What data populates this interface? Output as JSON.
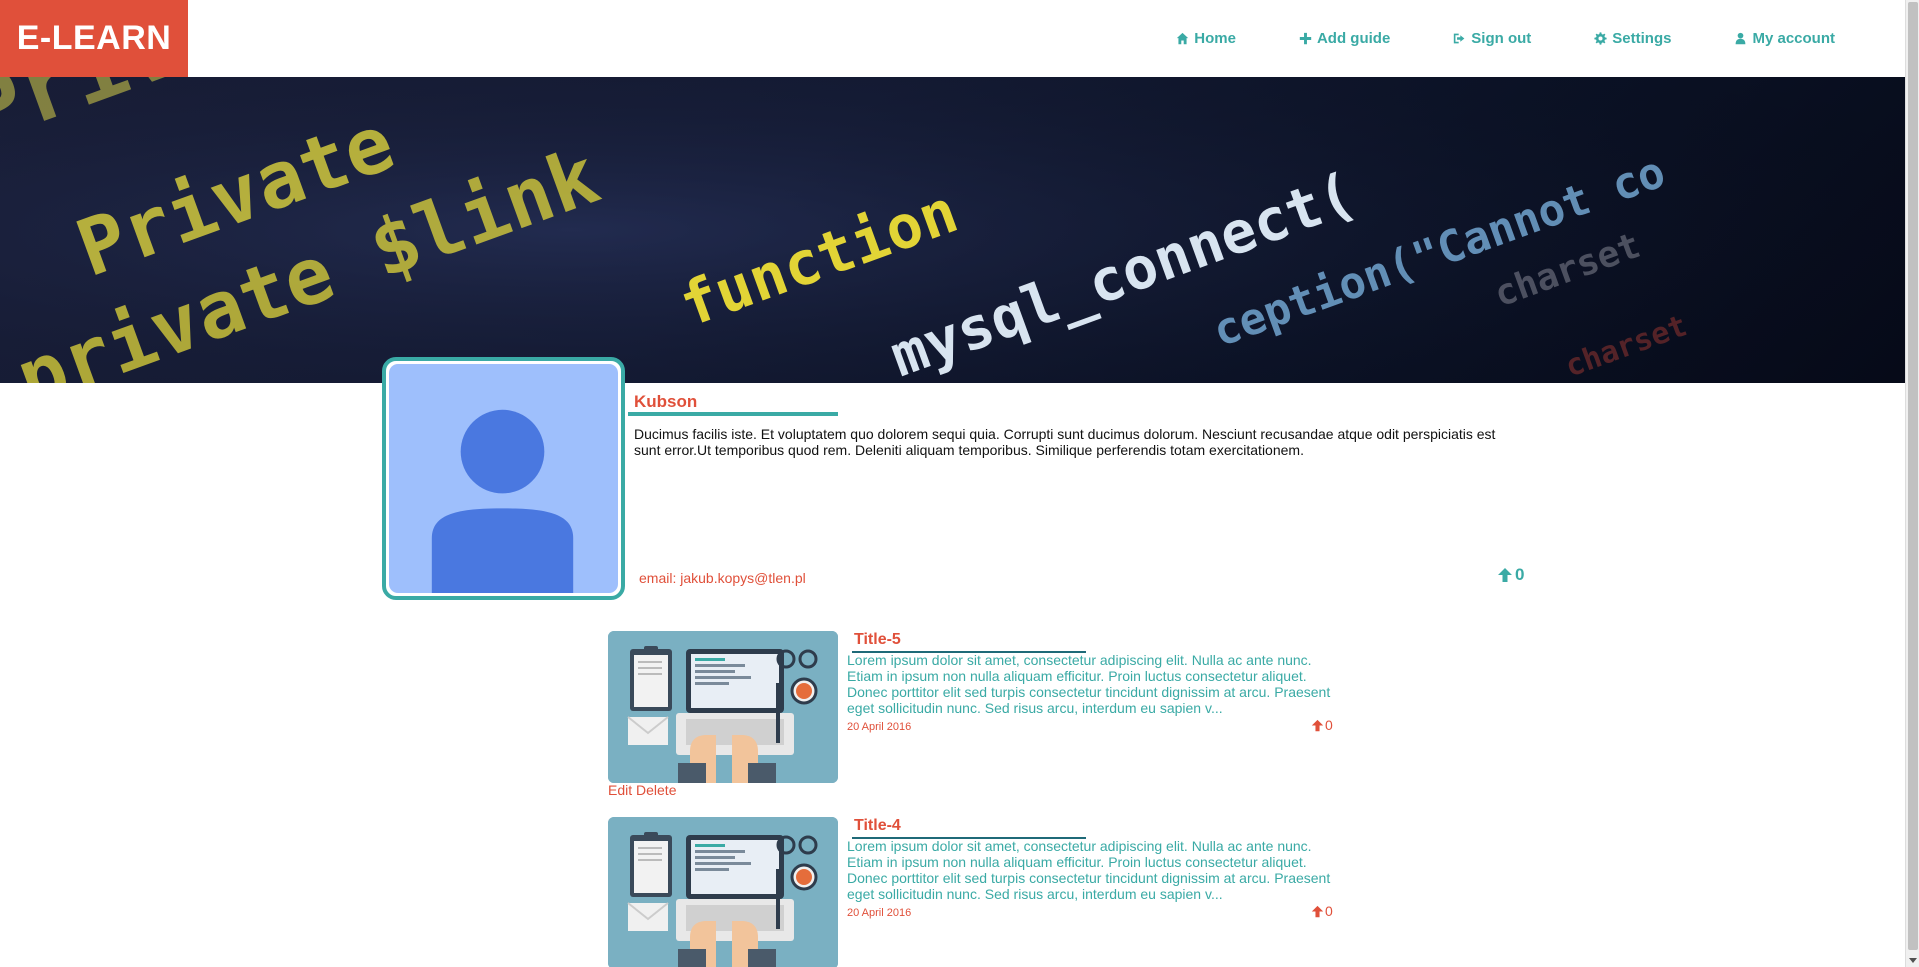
{
  "app": {
    "logo": "E-LEARN"
  },
  "nav": {
    "items": [
      {
        "label": "Home",
        "icon": "home-icon"
      },
      {
        "label": "Add guide",
        "icon": "plus-icon"
      },
      {
        "label": "Sign out",
        "icon": "sign-out-icon"
      },
      {
        "label": "Settings",
        "icon": "gear-icon"
      },
      {
        "label": "My account",
        "icon": "user-icon"
      }
    ]
  },
  "banner": {
    "code_lines": [
      "Private",
      "private $link",
      "function",
      "mysql_connect(",
      "ception(\"Cannot co",
      "charset"
    ]
  },
  "profile": {
    "username": "Kubson",
    "bio": "Ducimus facilis iste. Et voluptatem quo dolorem sequi quia. Corrupti sunt ducimus dolorum. Nesciunt recusandae atque odit perspiciatis est sunt error.Ut temporibus quod rem. Deleniti aliquam temporibus. Similique perferendis totam exercitationem.",
    "email": "email: jakub.kopys@tlen.pl",
    "votes": "0"
  },
  "guides": [
    {
      "title": "Title-5",
      "excerpt": "Lorem ipsum dolor sit amet, consectetur adipiscing elit. Nulla ac ante nunc. Etiam in ipsum non nulla aliquam efficitur. Proin luctus consectetur aliquet. Donec porttitor elit sed turpis consectetur tincidunt dignissim at arcu. Praesent eget sollicitudin nunc. Sed risus arcu, interdum eu sapien v...",
      "date": "20 April 2016",
      "votes": "0",
      "edit_label": "Edit",
      "delete_label": "Delete"
    },
    {
      "title": "Title-4",
      "excerpt": "Lorem ipsum dolor sit amet, consectetur adipiscing elit. Nulla ac ante nunc. Etiam in ipsum non nulla aliquam efficitur. Proin luctus consectetur aliquet. Donec porttitor elit sed turpis consectetur tincidunt dignissim at arcu. Praesent eget sollicitudin nunc. Sed risus arcu, interdum eu sapien v...",
      "date": "20 April 2016",
      "votes": "0"
    }
  ],
  "colors": {
    "accent": "#3aaaa5",
    "brand": "#e0503a",
    "avatar_bg": "#9ebffc",
    "avatar_fg": "#4a78e0"
  }
}
